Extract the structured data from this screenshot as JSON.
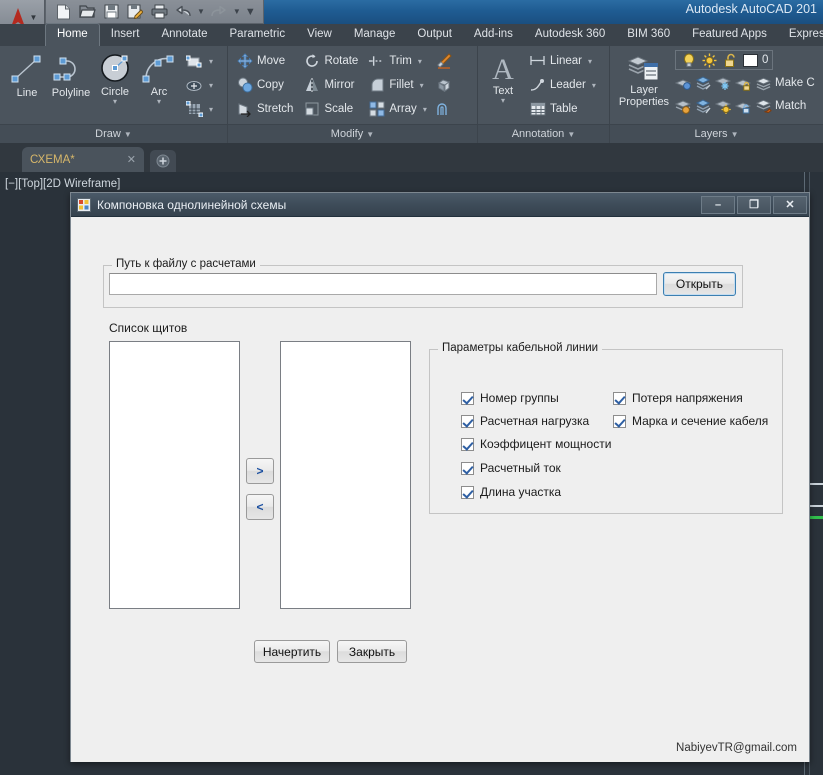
{
  "window": {
    "app_title": "Autodesk AutoCAD 201",
    "quick_access": [
      {
        "name": "new-icon",
        "label": "New"
      },
      {
        "name": "open-icon",
        "label": "Open"
      },
      {
        "name": "save-icon",
        "label": "Save"
      },
      {
        "name": "save-as-icon",
        "label": "Save As"
      },
      {
        "name": "plot-icon",
        "label": "Plot"
      },
      {
        "name": "undo-icon",
        "label": "Undo"
      },
      {
        "name": "undo-dropdown-icon",
        "label": "Undo options"
      },
      {
        "name": "redo-icon",
        "label": "Redo"
      },
      {
        "name": "redo-dropdown-icon",
        "label": "Redo options"
      },
      {
        "name": "qat-customize-icon",
        "label": "Customize Quick Access Toolbar"
      }
    ],
    "app_menu_icon": "autocad-a-icon"
  },
  "ribbon": {
    "tabs": [
      {
        "label": "Home",
        "active": true
      },
      {
        "label": "Insert",
        "active": false
      },
      {
        "label": "Annotate",
        "active": false
      },
      {
        "label": "Parametric",
        "active": false
      },
      {
        "label": "View",
        "active": false
      },
      {
        "label": "Manage",
        "active": false
      },
      {
        "label": "Output",
        "active": false
      },
      {
        "label": "Add-ins",
        "active": false
      },
      {
        "label": "Autodesk 360",
        "active": false
      },
      {
        "label": "BIM 360",
        "active": false
      },
      {
        "label": "Featured Apps",
        "active": false
      },
      {
        "label": "Express",
        "active": false
      }
    ],
    "panels": {
      "draw": {
        "label": "Draw",
        "items": [
          {
            "label": "Line",
            "icon": "line-icon"
          },
          {
            "label": "Polyline",
            "icon": "polyline-icon"
          },
          {
            "label": "Circle",
            "icon": "circle-icon",
            "caret": "▾"
          },
          {
            "label": "Arc",
            "icon": "arc-icon",
            "caret": "▾"
          }
        ],
        "small_items": [
          {
            "icon": "rectangle-icon",
            "caret": "▾"
          },
          {
            "icon": "ellipse-icon",
            "caret": "▾"
          },
          {
            "icon": "hatch-icon",
            "caret": "▾"
          }
        ]
      },
      "modify": {
        "label": "Modify",
        "col1": [
          {
            "label": "Move",
            "icon": "move-icon"
          },
          {
            "label": "Copy",
            "icon": "copy-icon"
          },
          {
            "label": "Stretch",
            "icon": "stretch-icon"
          }
        ],
        "col2": [
          {
            "label": "Rotate",
            "icon": "rotate-icon"
          },
          {
            "label": "Mirror",
            "icon": "mirror-icon"
          },
          {
            "label": "Scale",
            "icon": "scale-icon"
          }
        ],
        "col3": [
          {
            "label": "Trim",
            "icon": "trim-icon",
            "caret": "▾"
          },
          {
            "label": "Fillet",
            "icon": "fillet-icon",
            "caret": "▾"
          },
          {
            "label": "Array",
            "icon": "array-icon",
            "caret": "▾"
          }
        ],
        "col4": [
          {
            "icon": "match-properties-icon"
          },
          {
            "icon": "explode-icon"
          },
          {
            "icon": "offset-icon"
          }
        ]
      },
      "annotation": {
        "label": "Annotation",
        "big": {
          "label": "Text",
          "icon": "text-icon",
          "caret": "▾"
        },
        "items": [
          {
            "label": "Linear",
            "icon": "linear-dimension-icon",
            "caret": "▾"
          },
          {
            "label": "Leader",
            "icon": "leader-icon",
            "caret": "▾"
          },
          {
            "label": "Table",
            "icon": "table-icon"
          }
        ]
      },
      "layers": {
        "label": "Layers",
        "big": {
          "label": "Layer\nProperties",
          "line1": "Layer",
          "line2": "Properties",
          "icon": "layer-properties-icon"
        },
        "current_layer": "0",
        "status_icons": [
          {
            "icon": "lightbulb-icon"
          },
          {
            "icon": "sun-icon"
          },
          {
            "icon": "unlock-icon"
          }
        ],
        "row1_icons": [
          {
            "icon": "layer-isolate-icon"
          },
          {
            "icon": "layer-off-icon"
          },
          {
            "icon": "layer-freeze-icon"
          },
          {
            "icon": "layer-lock-icon"
          },
          {
            "icon": "layer-make-current-icon"
          }
        ],
        "row2_icons": [
          {
            "icon": "layer-unisolate-icon"
          },
          {
            "icon": "layer-turn-all-on-icon"
          },
          {
            "icon": "layer-thaw-all-icon"
          },
          {
            "icon": "layer-unlock-icon"
          },
          {
            "icon": "layer-match-icon"
          }
        ],
        "make_current_label": "Make C",
        "match_label": "Match"
      }
    }
  },
  "document": {
    "tab_label": "СХЕМА*",
    "tab_close": "✕",
    "new_tab": "+",
    "viewport_label": "[−][Top][2D Wireframe]"
  },
  "dialog": {
    "title": "Компоновка однолинейной схемы",
    "icon": "app-window-icon",
    "window_buttons": {
      "minimize": "–",
      "maximize": "❐",
      "close": "✕"
    },
    "file_group": {
      "legend": "Путь к файлу с расчетами",
      "path_value": "",
      "path_placeholder": "",
      "open_button": "Открыть"
    },
    "panels_section": {
      "caption": "Список щитов",
      "left_list_items": [],
      "right_list_items": [],
      "move_right_button": ">",
      "move_left_button": "<"
    },
    "cable_group": {
      "legend": "Параметры  кабельной линии",
      "left_checkboxes": [
        {
          "label": "Номер группы",
          "checked": true
        },
        {
          "label": "Расчетная нагрузка",
          "checked": true
        },
        {
          "label": "Коэффицент мощности",
          "checked": true
        },
        {
          "label": "Расчетный ток",
          "checked": true
        },
        {
          "label": "Длина участка",
          "checked": true
        }
      ],
      "right_checkboxes": [
        {
          "label": "Потеря напряжения",
          "checked": true
        },
        {
          "label": "Марка и сечение кабеля",
          "checked": true
        }
      ]
    },
    "actions": {
      "draw_button": "Начертить",
      "close_button": "Закрыть"
    },
    "footer_email": "NabiyevTR@gmail.com"
  },
  "colors": {
    "titlebar_blue": "#1f5c92",
    "ribbon_bg": "#4b545d",
    "canvas_bg": "#2a323a",
    "dialog_bg": "#efefef",
    "dialog_titlebar": "#3e4c59",
    "tab_text_gold": "#d7b76a",
    "accent_green": "#32c04d",
    "focus_blue": "#3c7fb1"
  }
}
